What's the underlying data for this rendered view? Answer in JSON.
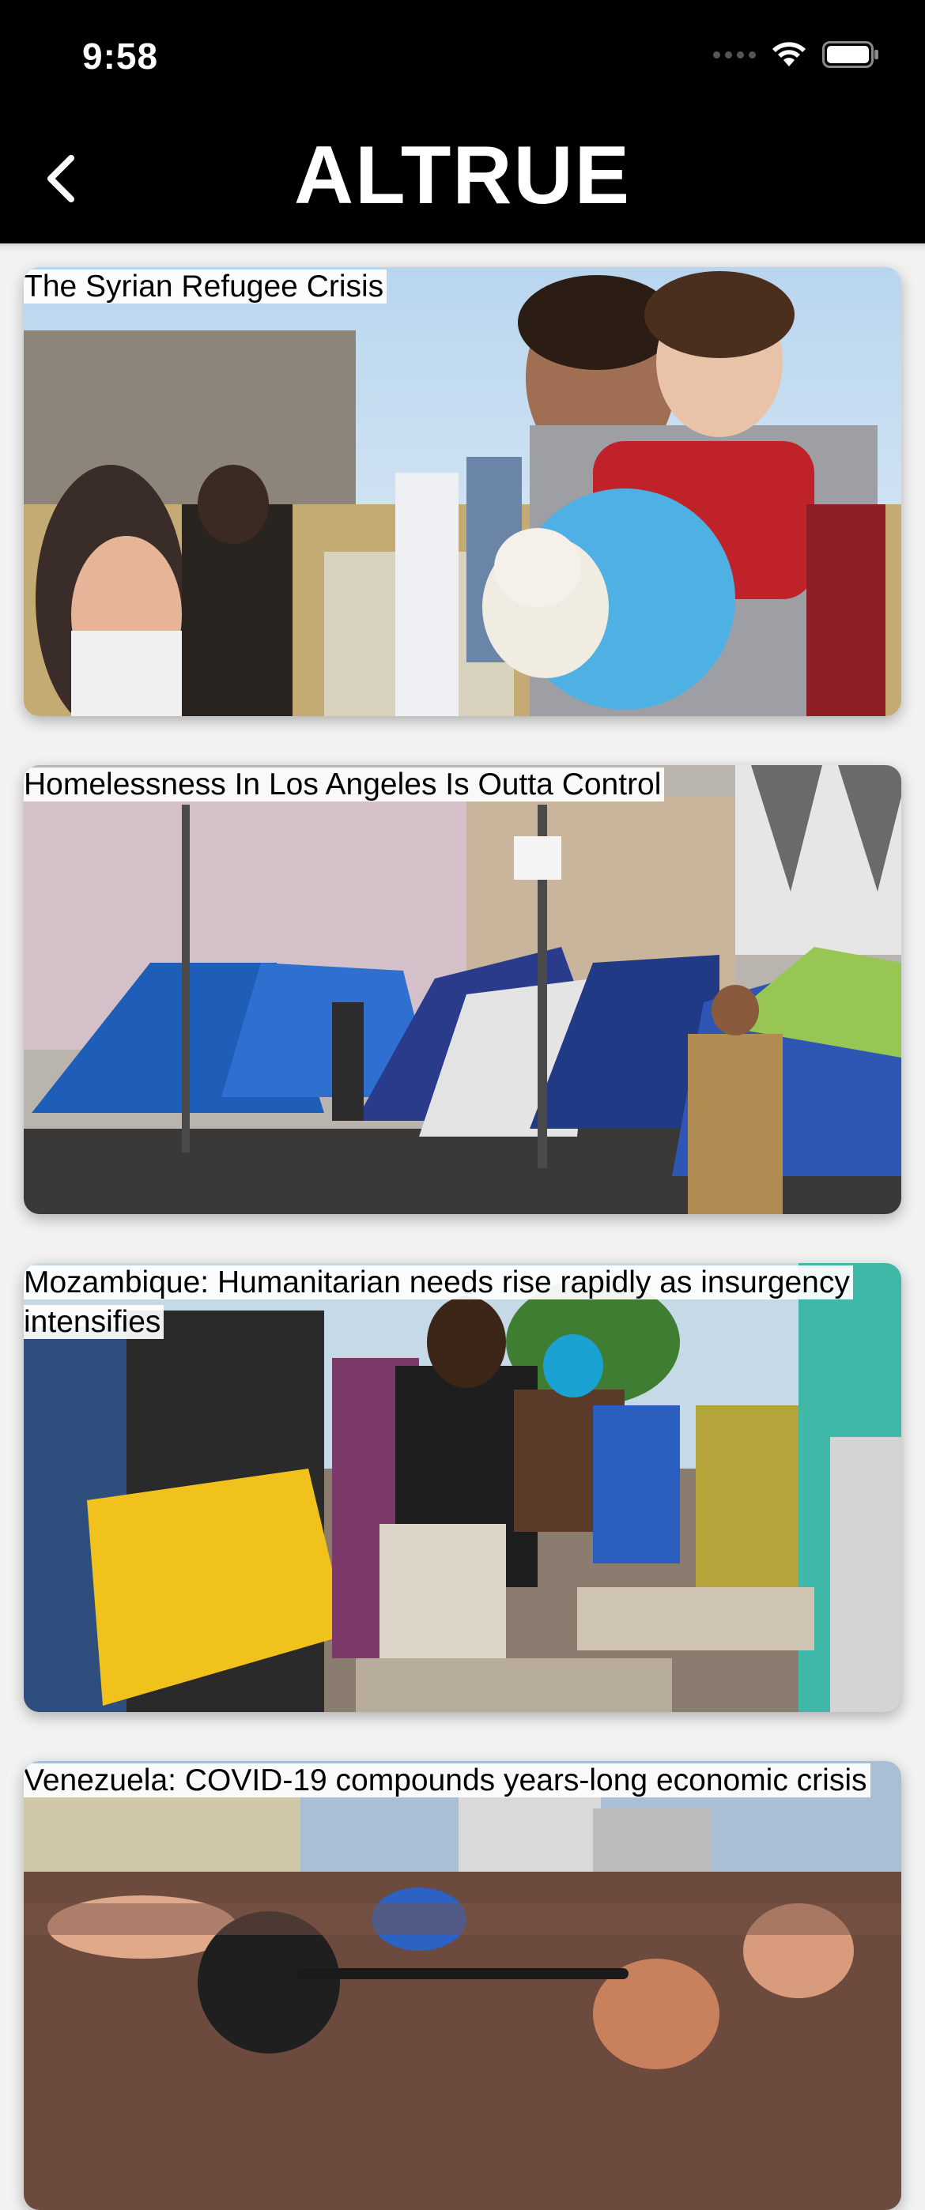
{
  "status_bar": {
    "time": "9:58"
  },
  "nav": {
    "logo_text": "ALTRUE",
    "back_icon": "chevron-left-icon"
  },
  "feed": {
    "items": [
      {
        "title": "The Syrian Refugee Crisis"
      },
      {
        "title": "Homelessness In Los Angeles Is Outta Control"
      },
      {
        "title": "Mozambique: Humanitarian needs rise rapidly as insurgency intensifies"
      },
      {
        "title": "Venezuela: COVID-19 compounds years-long economic crisis"
      }
    ]
  },
  "colors": {
    "nav_background": "#000000",
    "page_background": "#f2f2f2",
    "title_background": "#ffffff"
  }
}
